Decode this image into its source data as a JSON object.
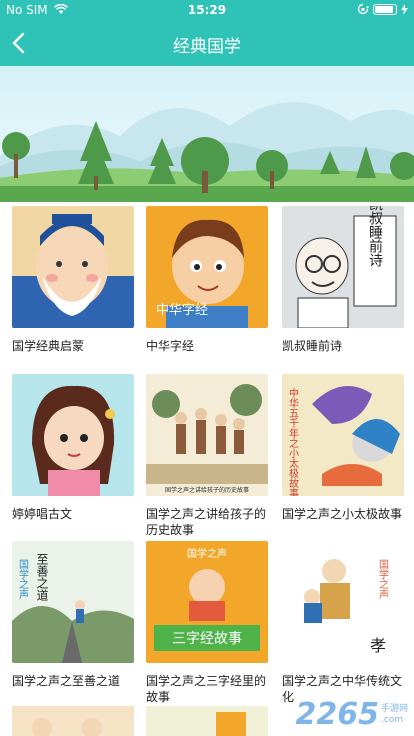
{
  "status": {
    "carrier": "No SIM",
    "time": "15:29",
    "battery_level": 0.9
  },
  "nav": {
    "title": "经典国学"
  },
  "items": [
    {
      "label": "国学经典启蒙"
    },
    {
      "label": "中华字经"
    },
    {
      "label": "凯叔睡前诗"
    },
    {
      "label": "婷婷唱古文"
    },
    {
      "label": "国学之声之讲给孩子的历史故事"
    },
    {
      "label": "国学之声之小太极故事"
    },
    {
      "label": "国学之声之至善之道"
    },
    {
      "label": "国学之声之三字经里的故事"
    },
    {
      "label": "国学之声之中华传统文化"
    }
  ],
  "thumbs": {
    "t2": "中华字经",
    "t3": "凯叔睡前诗",
    "t5": "国学之声之讲给孩子的历史故事",
    "t6": "中华五千年之小太极故事",
    "t7a": "国学之声",
    "t7b": "至善之道",
    "t8a": "国学之声",
    "t8b": "三字经故事",
    "t9a": "国学之声",
    "t9b": "孝"
  },
  "watermark": {
    "number": "2265",
    "suffix": ".com",
    "site": "手游网"
  }
}
